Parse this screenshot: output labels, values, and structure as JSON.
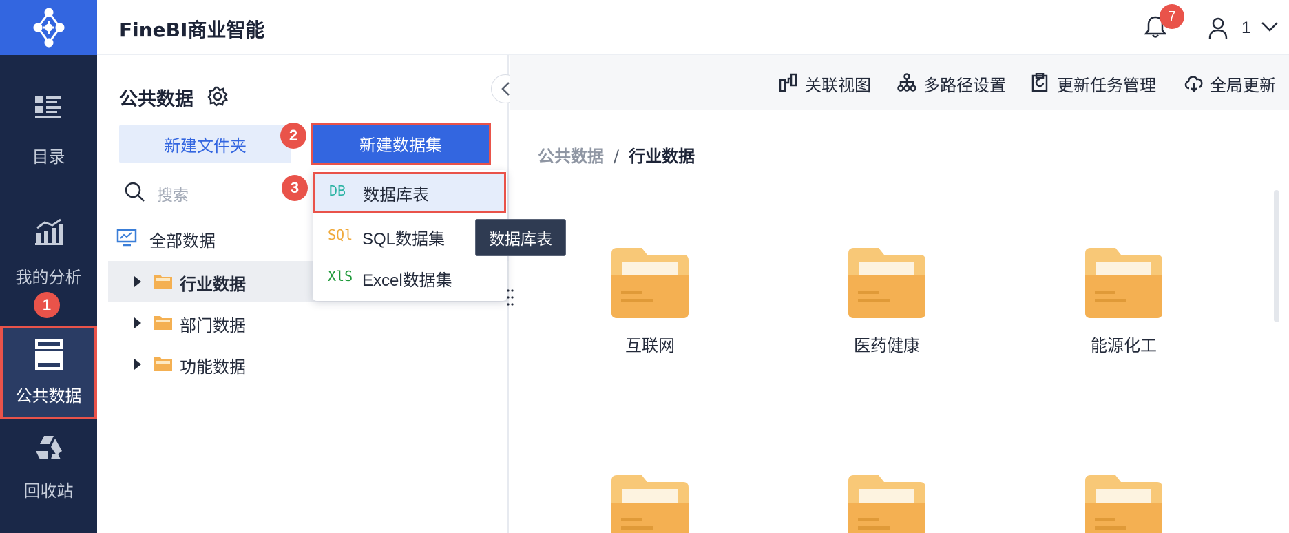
{
  "app": {
    "title": "FineBI商业智能"
  },
  "nav": {
    "items": [
      {
        "label": "目录",
        "icon": "catalog-icon"
      },
      {
        "label": "我的分析",
        "icon": "analysis-chart-icon"
      },
      {
        "label": "公共数据",
        "icon": "public-data-icon"
      },
      {
        "label": "回收站",
        "icon": "recycle-icon"
      }
    ],
    "active": "公共数据"
  },
  "steps": [
    "1",
    "2",
    "3"
  ],
  "header": {
    "notification_count": "7",
    "user_name": "1"
  },
  "panel": {
    "title": "公共数据",
    "new_folder_label": "新建文件夹",
    "new_dataset_label": "新建数据集",
    "search_placeholder": "搜索",
    "tree_root": "全部数据",
    "tree": [
      {
        "label": "行业数据",
        "selected": true
      },
      {
        "label": "部门数据",
        "selected": false
      },
      {
        "label": "功能数据",
        "selected": false
      }
    ]
  },
  "dropdown": {
    "items": [
      {
        "tag": "DB",
        "label": "数据库表",
        "tag_color": "#2bb3a3"
      },
      {
        "tag": "SQl",
        "label": "SQL数据集",
        "tag_color": "#f0a93a"
      },
      {
        "tag": "XlS",
        "label": "Excel数据集",
        "tag_color": "#1f9a3a"
      }
    ],
    "tooltip": "数据库表"
  },
  "toolbar": {
    "items": [
      {
        "label": "关联视图",
        "icon": "relation-view-icon"
      },
      {
        "label": "多路径设置",
        "icon": "multipath-icon"
      },
      {
        "label": "更新任务管理",
        "icon": "update-task-icon"
      },
      {
        "label": "全局更新",
        "icon": "global-update-icon"
      }
    ]
  },
  "breadcrumb": {
    "parent": "公共数据",
    "separator": "/",
    "current": "行业数据"
  },
  "folders": [
    {
      "label": "互联网"
    },
    {
      "label": "医药健康"
    },
    {
      "label": "能源化工"
    },
    {
      "label": ""
    },
    {
      "label": ""
    },
    {
      "label": ""
    }
  ],
  "colors": {
    "accent": "#3366e0",
    "nav_bg": "#1a2848",
    "highlight_border": "#e9534a",
    "folder": "#f4b052"
  }
}
